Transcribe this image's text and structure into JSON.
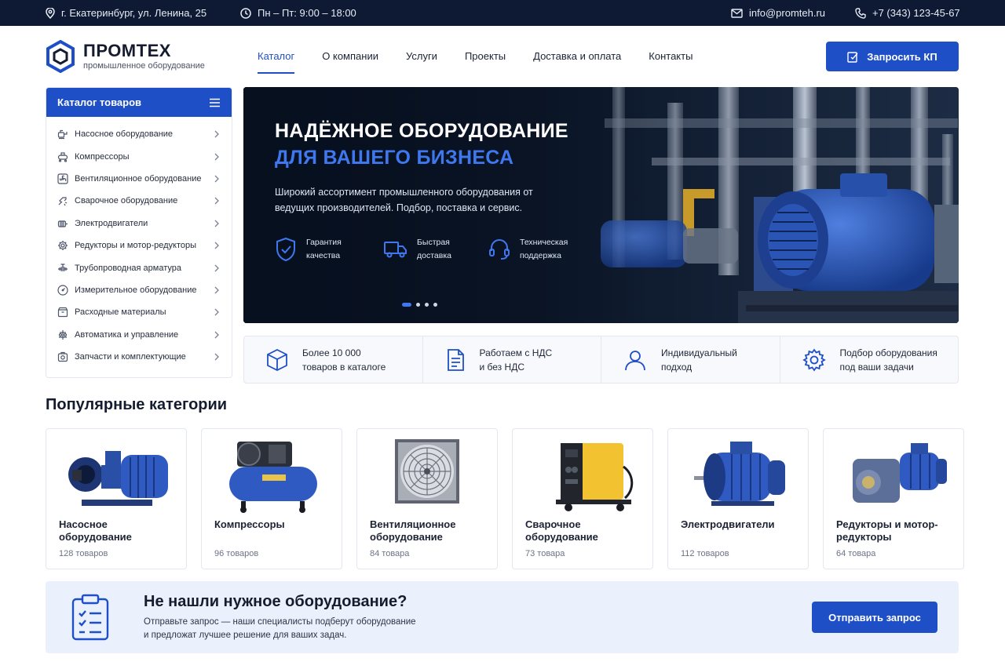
{
  "colors": {
    "primary": "#1f4fc7",
    "dark": "#0e1a33",
    "accent_text": "#3f78ee"
  },
  "topbar": {
    "address": "г. Екатеринбург, ул. Ленина, 25",
    "hours": "Пн – Пт: 9:00 – 18:00",
    "email": "info@promteh.ru",
    "phone": "+7 (343) 123-45-67",
    "icons": [
      "location-pin-icon",
      "clock-icon",
      "mail-icon",
      "phone-icon"
    ]
  },
  "header": {
    "logo_name": "ПРОМТЕХ",
    "logo_sub": "промышленное оборудование",
    "nav": [
      {
        "label": "Каталог",
        "active": true
      },
      {
        "label": "О компании"
      },
      {
        "label": "Услуги"
      },
      {
        "label": "Проекты"
      },
      {
        "label": "Доставка и оплата"
      },
      {
        "label": "Контакты"
      }
    ],
    "cta_label": "Запросить КП"
  },
  "sidebar": {
    "title": "Каталог товаров",
    "items": [
      {
        "label": "Насосное оборудование",
        "icon": "pump-icon"
      },
      {
        "label": "Компрессоры",
        "icon": "compressor-icon"
      },
      {
        "label": "Вентиляционное оборудование",
        "icon": "fan-icon"
      },
      {
        "label": "Сварочное оборудование",
        "icon": "welding-icon"
      },
      {
        "label": "Электродвигатели",
        "icon": "motor-icon"
      },
      {
        "label": "Редукторы и мотор-редукторы",
        "icon": "gear-icon"
      },
      {
        "label": "Трубопроводная арматура",
        "icon": "valve-icon"
      },
      {
        "label": "Измерительное оборудование",
        "icon": "gauge-icon"
      },
      {
        "label": "Расходные материалы",
        "icon": "box-icon"
      },
      {
        "label": "Автоматика и управление",
        "icon": "automation-icon"
      },
      {
        "label": "Запчасти и комплектующие",
        "icon": "parts-icon"
      }
    ]
  },
  "hero": {
    "title_line1": "НАДЁЖНОЕ ОБОРУДОВАНИЕ",
    "title_line2": "ДЛЯ ВАШЕГО БИЗНЕСА",
    "description": "Широкий ассортимент промышленного оборудования от ведущих производителей. Подбор, поставка и сервис.",
    "features": [
      {
        "line1": "Гарантия",
        "line2": "качества",
        "icon": "shield-check-icon"
      },
      {
        "line1": "Быстрая",
        "line2": "доставка",
        "icon": "truck-icon"
      },
      {
        "line1": "Техническая",
        "line2": "поддержка",
        "icon": "headset-icon"
      }
    ],
    "slides_count": 4,
    "active_slide": 1
  },
  "advantages": [
    {
      "line1": "Более 10 000",
      "line2": "товаров в каталоге",
      "icon": "cube-icon"
    },
    {
      "line1": "Работаем с НДС",
      "line2": "и без НДС",
      "icon": "document-icon"
    },
    {
      "line1": "Индивидуальный",
      "line2": "подход",
      "icon": "user-icon"
    },
    {
      "line1": "Подбор оборудования",
      "line2": "под ваши задачи",
      "icon": "settings-icon"
    }
  ],
  "popular": {
    "title": "Популярные категории",
    "cards": [
      {
        "name": "Насосное оборудование",
        "count": "128 товаров",
        "image": "pump-image"
      },
      {
        "name": "Компрессоры",
        "count": "96 товаров",
        "image": "compressor-image"
      },
      {
        "name": "Вентиляционное оборудование",
        "count": "84 товара",
        "image": "fan-image"
      },
      {
        "name": "Сварочное оборудование",
        "count": "73 товара",
        "image": "welder-image"
      },
      {
        "name": "Электродвигатели",
        "count": "112 товаров",
        "image": "motor-image"
      },
      {
        "name": "Редукторы и мотор-редукторы",
        "count": "64 товара",
        "image": "gear-motor-image"
      }
    ]
  },
  "request": {
    "title": "Не нашли нужное оборудование?",
    "line1": "Отправьте запрос — наши специалисты подберут оборудование",
    "line2": "и предложат лучшее решение для ваших задач.",
    "button": "Отправить запрос"
  }
}
